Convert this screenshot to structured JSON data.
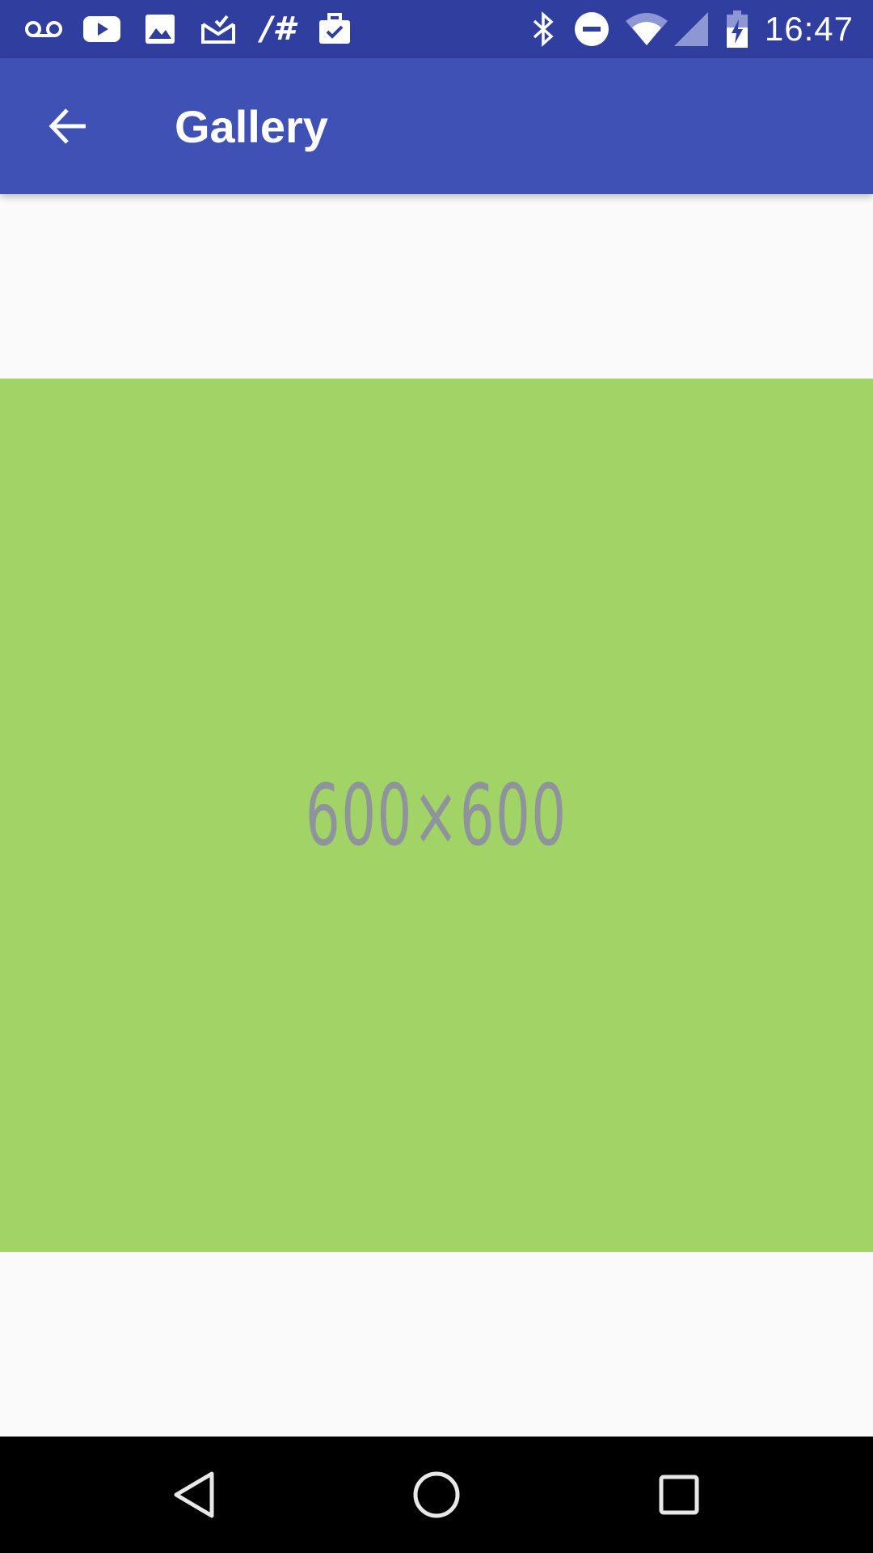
{
  "status_bar": {
    "time": "16:47",
    "left_icons": [
      "voicemail-icon",
      "youtube-icon",
      "image-icon",
      "mail-check-icon",
      "hash-icon",
      "work-check-icon"
    ],
    "right_icons": [
      "bluetooth-icon",
      "do-not-disturb-icon",
      "wifi-icon",
      "cell-signal-icon",
      "battery-charging-icon"
    ],
    "hash_text": "/#"
  },
  "app_bar": {
    "title": "Gallery",
    "back_icon": "arrow-back-icon",
    "background": "#3f51b5"
  },
  "gallery": {
    "image_label": "600×600",
    "image_background": "#a2d366"
  },
  "nav_bar": {
    "buttons": [
      "back-triangle-icon",
      "home-circle-icon",
      "recents-square-icon"
    ]
  }
}
